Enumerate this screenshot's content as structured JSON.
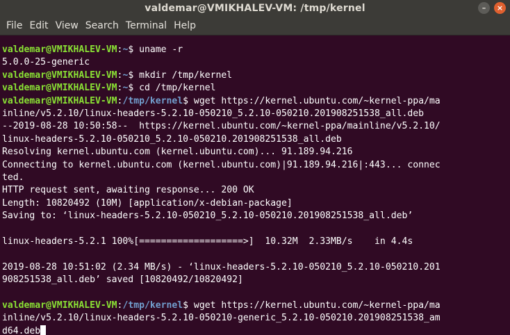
{
  "window": {
    "title": "valdemar@VMIKHALEV-VM: /tmp/kernel",
    "minimize_glyph": "–",
    "close_glyph": "×"
  },
  "menu": [
    "File",
    "Edit",
    "View",
    "Search",
    "Terminal",
    "Help"
  ],
  "prompt": {
    "user_host": "valdemar@VMIKHALEV-VM",
    "home_dir": "~",
    "tmp_dir": "/tmp/kernel"
  },
  "lines": [
    {
      "type": "prompt",
      "dir": "~",
      "cmd": " uname -r"
    },
    {
      "type": "out",
      "text": "5.0.0-25-generic"
    },
    {
      "type": "prompt",
      "dir": "~",
      "cmd": " mkdir /tmp/kernel"
    },
    {
      "type": "prompt",
      "dir": "~",
      "cmd": " cd /tmp/kernel"
    },
    {
      "type": "prompt",
      "dir": "/tmp/kernel",
      "cmd": " wget https://kernel.ubuntu.com/~kernel-ppa/ma"
    },
    {
      "type": "out",
      "text": "inline/v5.2.10/linux-headers-5.2.10-050210_5.2.10-050210.201908251538_all.deb"
    },
    {
      "type": "out",
      "text": "--2019-08-28 10:50:58--  https://kernel.ubuntu.com/~kernel-ppa/mainline/v5.2.10/"
    },
    {
      "type": "out",
      "text": "linux-headers-5.2.10-050210_5.2.10-050210.201908251538_all.deb"
    },
    {
      "type": "out",
      "text": "Resolving kernel.ubuntu.com (kernel.ubuntu.com)... 91.189.94.216"
    },
    {
      "type": "out",
      "text": "Connecting to kernel.ubuntu.com (kernel.ubuntu.com)|91.189.94.216|:443... connec"
    },
    {
      "type": "out",
      "text": "ted."
    },
    {
      "type": "out",
      "text": "HTTP request sent, awaiting response... 200 OK"
    },
    {
      "type": "out",
      "text": "Length: 10820492 (10M) [application/x-debian-package]"
    },
    {
      "type": "out",
      "text": "Saving to: ‘linux-headers-5.2.10-050210_5.2.10-050210.201908251538_all.deb’"
    },
    {
      "type": "out",
      "text": ""
    },
    {
      "type": "out",
      "text": "linux-headers-5.2.1 100%[===================>]  10.32M  2.33MB/s    in 4.4s"
    },
    {
      "type": "out",
      "text": ""
    },
    {
      "type": "out",
      "text": "2019-08-28 10:51:02 (2.34 MB/s) - ‘linux-headers-5.2.10-050210_5.2.10-050210.201"
    },
    {
      "type": "out",
      "text": "908251538_all.deb’ saved [10820492/10820492]"
    },
    {
      "type": "out",
      "text": ""
    },
    {
      "type": "prompt",
      "dir": "/tmp/kernel",
      "cmd": " wget https://kernel.ubuntu.com/~kernel-ppa/ma"
    },
    {
      "type": "out",
      "text": "inline/v5.2.10/linux-headers-5.2.10-050210-generic_5.2.10-050210.201908251538_am"
    },
    {
      "type": "out",
      "text": "d64.deb",
      "cursor": true
    }
  ],
  "colors": {
    "background": "#300a24",
    "user_host": "#8ae234",
    "path": "#729fcf",
    "text": "#ffffff"
  }
}
